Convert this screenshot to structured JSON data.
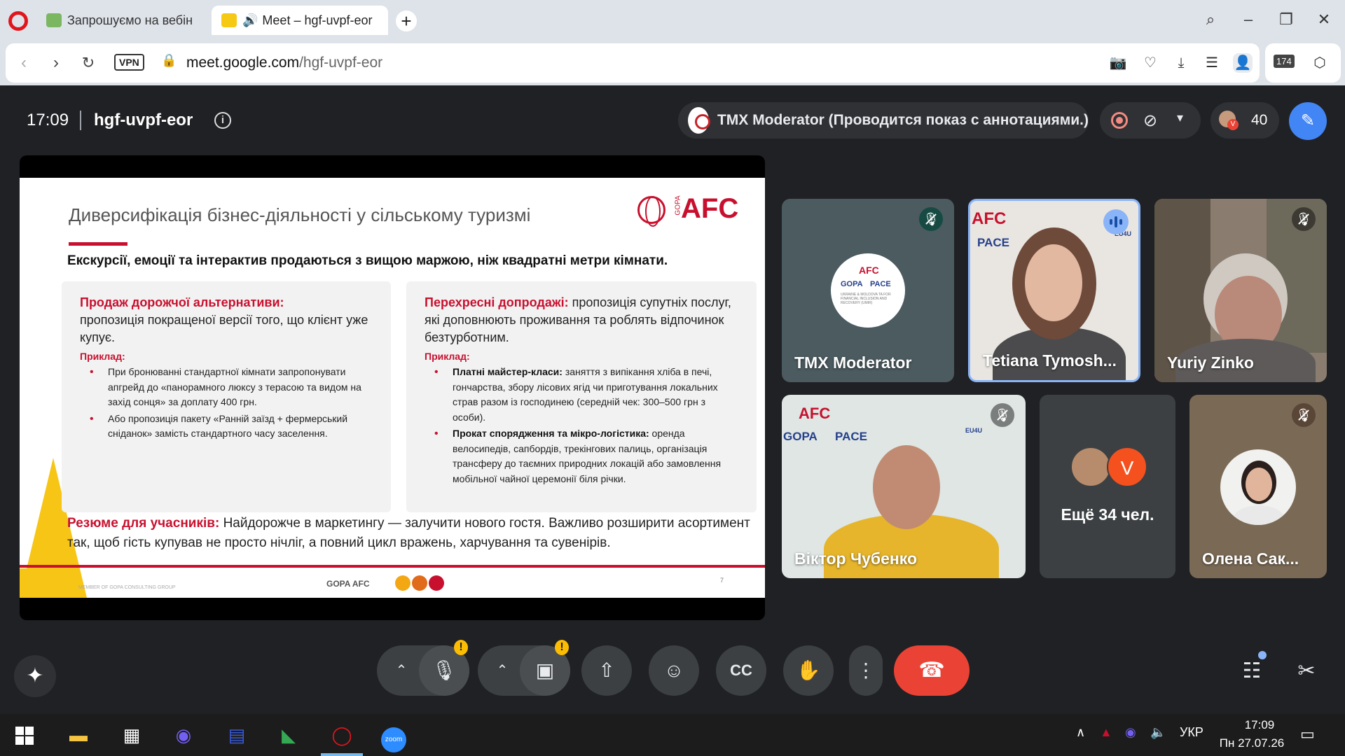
{
  "browser": {
    "tabs": [
      {
        "title": "Запрошуємо на вебінар"
      },
      {
        "title": "Meet – hgf-uvpf-eor"
      }
    ],
    "vpn_label": "VPN",
    "url_host": "meet.google.com",
    "url_path": "/hgf-uvpf-eor",
    "extension_badge": "174"
  },
  "meet": {
    "time": "17:09",
    "meeting_code": "hgf-uvpf-eor",
    "presenter_status": "TMX Moderator (Проводится показ с аннотациями.)",
    "people_count": "40",
    "more_avatar_letter": "V",
    "more_label": "Ещё 34 чел."
  },
  "slide": {
    "title": "Диверсифікація бізнес-діяльності у сільському туризмі",
    "logo_text": "AFC",
    "logo_gopa": "GOPA",
    "subtitle": "Екскурсії, емоції та інтерактив продаються з вищою маржою, ніж квадратні метри кімнати.",
    "card1": {
      "heading": "Продаж дорожчої альтернативи:",
      "text": "пропозиція покращеної версії того, що клієнт уже купує.",
      "example_label": "Приклад:",
      "items": [
        "При бронюванні стандартної кімнати запропонувати апгрейд до «панорамного люксу з терасою та видом на захід сонця» за доплату 400 грн.",
        "Або пропозиція пакету «Ранній заїзд + фермерський сніданок» замість стандартного часу заселення."
      ]
    },
    "card2": {
      "heading": "Перехресні допродажі:",
      "text": "пропозиція супутніх послуг, які доповнюють проживання та роблять відпочинок безтурботним.",
      "example_label": "Приклад:",
      "items": [
        {
          "bold": "Платні майстер-класи:",
          "text": "заняття з випікання хліба в печі, гончарства, збору лісових ягід чи приготування локальних страв разом із господинею (середній чек: 300–500 грн з особи)."
        },
        {
          "bold": "Прокат спорядження та мікро-логістика:",
          "text": "оренда велосипедів, сапбордів, трекінгових палиць, організація трансферу до таємних природних локацій або замовлення мобільної чайної церемонії біля річки."
        }
      ]
    },
    "summary_bold": "Резюме для учасників:",
    "summary_text": "Найдорожче в маркетингу — залучити нового гостя. Важливо розширити асортимент так, щоб гість купував не просто нічліг, а повний цикл вражень, харчування та сувенірів.",
    "footer_small": "MEMBER OF GOPA CONSULTING GROUP",
    "footer_brand": "GOPA AFC",
    "page_number": "7"
  },
  "participants": [
    {
      "name": "TMX Moderator",
      "muted": true
    },
    {
      "name": "Tetiana Tymosh...",
      "speaking": true
    },
    {
      "name": "Yuriy Zinko",
      "muted": true
    },
    {
      "name": "Віктор Чубенко",
      "muted": true
    },
    {
      "name": "Олена Сак...",
      "muted": true
    }
  ],
  "tile_logos": {
    "afc": "AFC",
    "gopa": "GOPA",
    "pace": "PACE",
    "eu4u": "EU4U",
    "ukraine_moldova": "UKRAINE & MOLDOVA TA FOR FINANCIAL INCLUSION AND RECOVERY (UMIR)"
  },
  "taskbar": {
    "lang": "УКР",
    "time": "17:09",
    "date": "Пн 27.07.26",
    "zoom_label": "zoom"
  },
  "colors": {
    "brand_red": "#c8102e",
    "meet_bg": "#202124",
    "end_call": "#ea4335",
    "accent_blue": "#4285f4"
  }
}
